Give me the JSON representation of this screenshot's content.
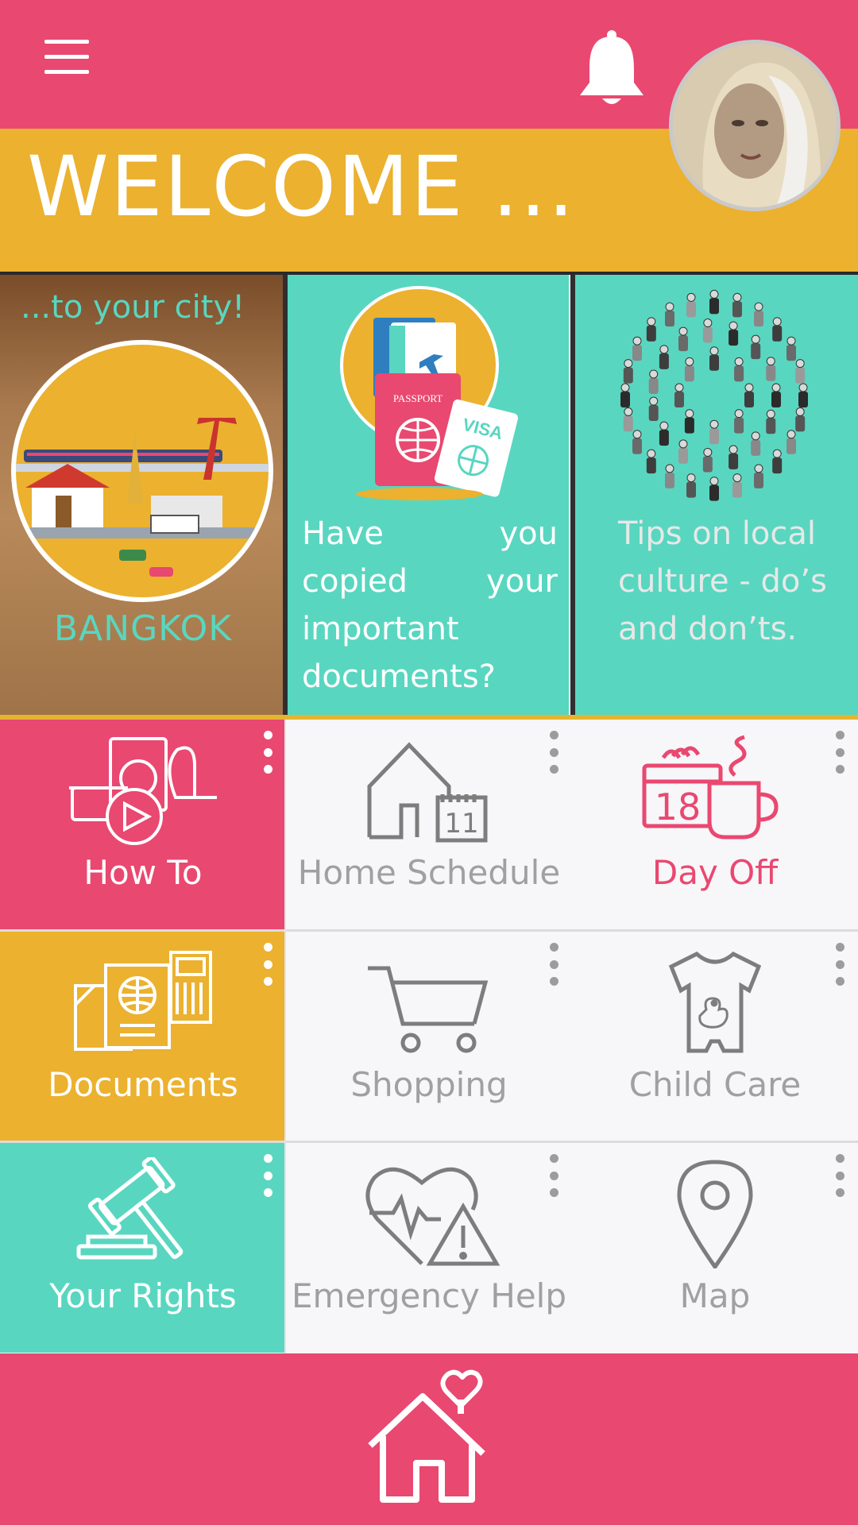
{
  "header": {
    "welcome": "WELCOME ...",
    "menu_icon": "hamburger-menu-icon",
    "bell_icon": "bell-icon"
  },
  "cards": {
    "city": {
      "tag": "...to your city!",
      "name": "BANGKOK"
    },
    "documents": {
      "text": "Have you copied your important documents?"
    },
    "culture": {
      "text": "Tips on local culture - do’s and don’ts."
    }
  },
  "tiles": {
    "how_to": "How To",
    "home_schedule": "Home Schedule",
    "schedule_day": "11",
    "day_off": "Day Off",
    "day_off_date": "18",
    "documents": "Documents",
    "shopping": "Shopping",
    "child_care": "Child Care",
    "your_rights": "Your Rights",
    "emergency_help": "Emergency Help",
    "map": "Map"
  },
  "colors": {
    "pink": "#e94870",
    "yellow": "#ebb12f",
    "teal": "#59d6c0",
    "gray_icon": "#7d7d7d",
    "gray_text": "#9c9c9c"
  }
}
